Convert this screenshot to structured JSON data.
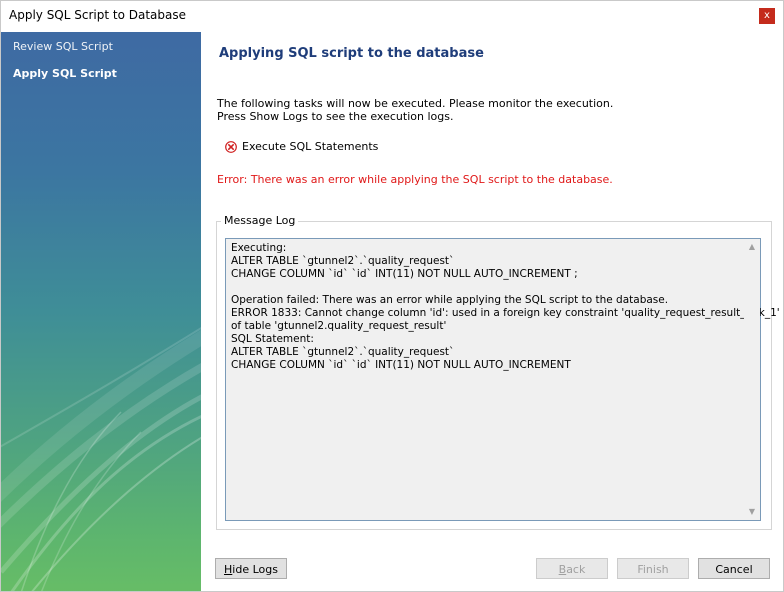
{
  "window": {
    "title": "Apply SQL Script to Database",
    "close_label": "x"
  },
  "sidebar": {
    "steps": [
      {
        "label": "Review SQL Script",
        "active": false
      },
      {
        "label": "Apply SQL Script",
        "active": true
      }
    ]
  },
  "main": {
    "heading": "Applying SQL script to the database",
    "description_line1": "The following tasks will now be executed. Please monitor the execution.",
    "description_line2": "Press Show Logs to see the execution logs.",
    "task_label": "Execute SQL Statements",
    "error_message": "Error: There was an error while applying the SQL script to the database.",
    "message_log_label": "Message Log",
    "log_text": "Executing:\nALTER TABLE `gtunnel2`.`quality_request`\nCHANGE COLUMN `id` `id` INT(11) NOT NULL AUTO_INCREMENT ;\n\nOperation failed: There was an error while applying the SQL script to the database.\nERROR 1833: Cannot change column 'id': used in a foreign key constraint 'quality_request_result_ibfk_1'\nof table 'gtunnel2.quality_request_result'\nSQL Statement:\nALTER TABLE `gtunnel2`.`quality_request`\nCHANGE COLUMN `id` `id` INT(11) NOT NULL AUTO_INCREMENT"
  },
  "buttons": {
    "hide_logs_first": "H",
    "hide_logs_rest": "ide Logs",
    "back_first": "B",
    "back_rest": "ack",
    "finish": "Finish",
    "cancel": "Cancel"
  },
  "icons": {
    "error": "error-circle-icon",
    "scroll_up": "chevron-up-icon",
    "scroll_down": "chevron-down-icon"
  },
  "colors": {
    "heading": "#1f3d7a",
    "error_text": "#e01818",
    "close_button": "#c42b1c"
  }
}
